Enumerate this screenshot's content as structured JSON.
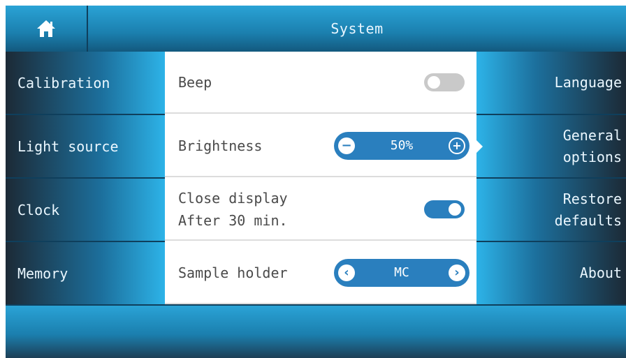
{
  "header": {
    "title": "System",
    "home_icon": "home-icon"
  },
  "left_menu": [
    {
      "label": "Calibration"
    },
    {
      "label": "Light source"
    },
    {
      "label": "Clock"
    },
    {
      "label": "Memory"
    }
  ],
  "right_menu": [
    {
      "label": "Language"
    },
    {
      "label": "General options",
      "line1": "General",
      "line2": "options",
      "selected": true
    },
    {
      "label": "Restore defaults",
      "line1": "Restore",
      "line2": "defaults"
    },
    {
      "label": "About"
    }
  ],
  "settings": {
    "beep": {
      "label": "Beep",
      "state": "off"
    },
    "brightness": {
      "label": "Brightness",
      "value": "50%",
      "decrease_icon": "minus-icon",
      "increase_icon": "plus-icon"
    },
    "close_display": {
      "label_line1": "Close display",
      "label_line2": "After 30 min.",
      "state": "on"
    },
    "sample_holder": {
      "label": "Sample holder",
      "value": "MC",
      "prev_icon": "chevron-left-icon",
      "next_icon": "chevron-right-icon"
    }
  },
  "colors": {
    "accent": "#2a7fbe",
    "header_blue": "#1b7fae",
    "tile_dark": "#1c2a36",
    "toggle_off": "#c9c9c9"
  }
}
